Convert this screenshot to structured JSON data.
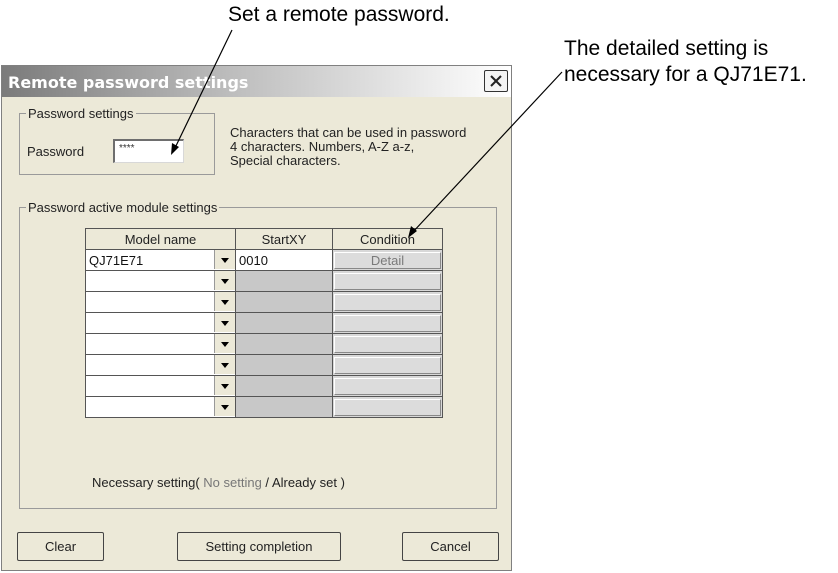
{
  "annotations": {
    "set_password": "Set a remote password.",
    "detail_line1": "The detailed setting is",
    "detail_line2": "necessary for a QJ71E71."
  },
  "dialog": {
    "title": "Remote password settings",
    "close_icon": "close-icon",
    "password_group": {
      "legend": "Password settings",
      "label": "Password",
      "value": "****"
    },
    "hint": {
      "line1": "Characters that can be used in password",
      "line2": " 4 characters. Numbers, A-Z a-z,",
      "line3": " Special characters."
    },
    "module_group": {
      "legend": "Password active module settings",
      "columns": [
        "Model name",
        "StartXY",
        "Condition"
      ],
      "rows": [
        {
          "model": "QJ71E71",
          "start": "0010",
          "condition": "Detail"
        },
        {
          "model": "",
          "start": "",
          "condition": ""
        },
        {
          "model": "",
          "start": "",
          "condition": ""
        },
        {
          "model": "",
          "start": "",
          "condition": ""
        },
        {
          "model": "",
          "start": "",
          "condition": ""
        },
        {
          "model": "",
          "start": "",
          "condition": ""
        },
        {
          "model": "",
          "start": "",
          "condition": ""
        },
        {
          "model": "",
          "start": "",
          "condition": ""
        }
      ],
      "status": {
        "prefix": "Necessary setting(",
        "no_setting": " No setting ",
        "slash": " / ",
        "already_set": "Already set",
        "suffix": "   )"
      }
    },
    "buttons": {
      "clear": "Clear",
      "complete": "Setting completion",
      "cancel": "Cancel"
    }
  }
}
